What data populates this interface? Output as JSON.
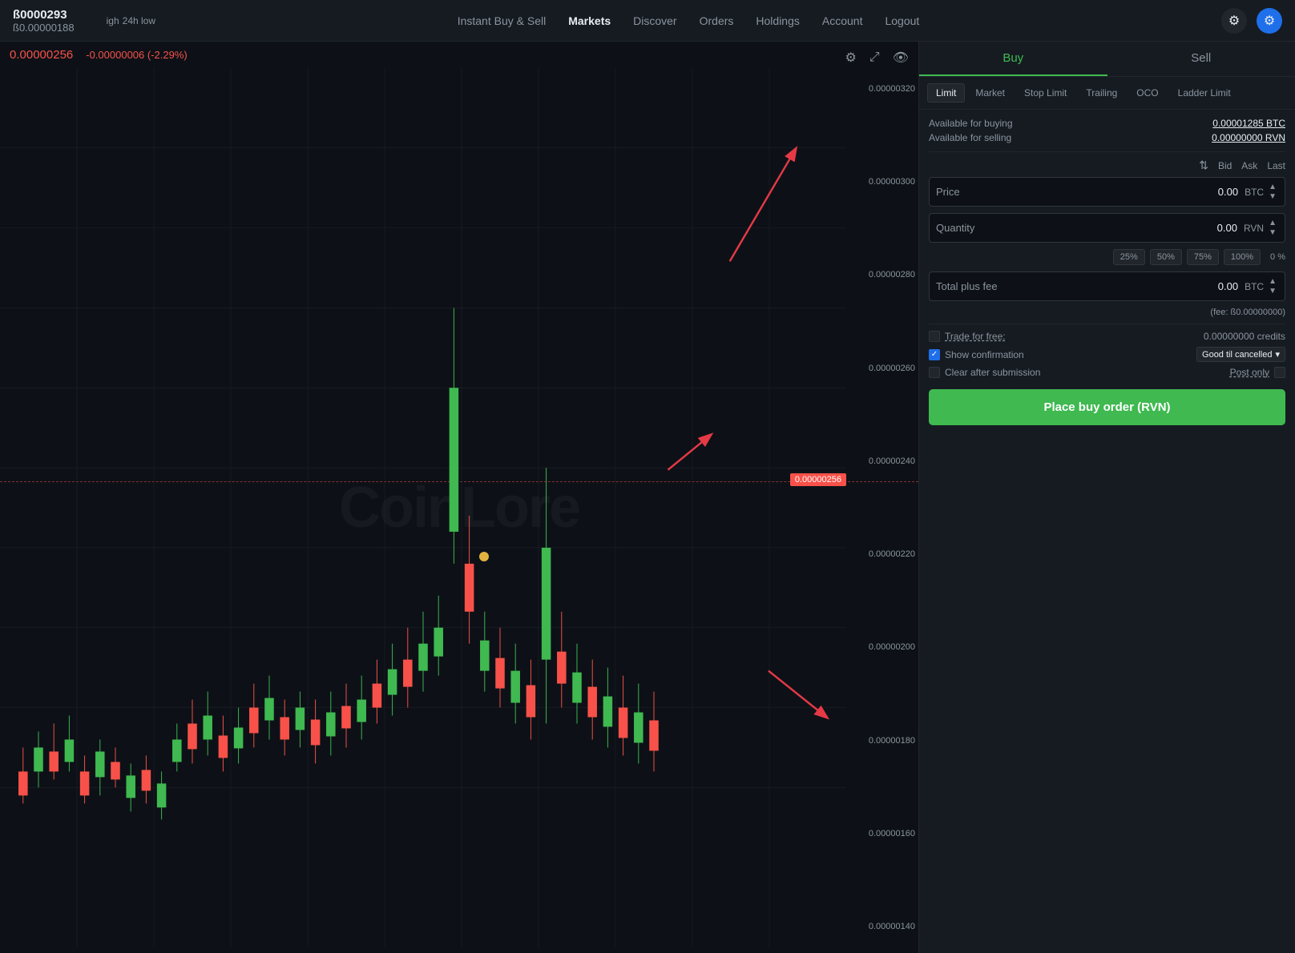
{
  "nav": {
    "ticker": "ß0000293",
    "price_low": "24h low",
    "price_high_label": "igh",
    "price_value": "ß0.00000188",
    "links": [
      {
        "label": "Instant Buy & Sell",
        "active": false
      },
      {
        "label": "Markets",
        "active": true
      },
      {
        "label": "Discover",
        "active": false
      },
      {
        "label": "Orders",
        "active": false
      },
      {
        "label": "Holdings",
        "active": false
      },
      {
        "label": "Account",
        "active": false
      },
      {
        "label": "Logout",
        "active": false
      }
    ]
  },
  "chart": {
    "current_price": "0.00000256",
    "price_change": "-0.00000006 (-2.29%)",
    "watermark": "CoinLore",
    "y_labels": [
      "0.00000320",
      "0.00000300",
      "0.00000280",
      "0.00000260",
      "0.00000240",
      "0.00000220",
      "0.00000200",
      "0.00000180",
      "0.00000160",
      "0.00000140"
    ],
    "price_tag": "0.00000256"
  },
  "order_panel": {
    "buy_label": "Buy",
    "sell_label": "Sell",
    "order_types": [
      "Limit",
      "Market",
      "Stop Limit",
      "Trailing",
      "OCO",
      "Ladder Limit"
    ],
    "available_buying_label": "Available for buying",
    "available_buying_value": "0.00001285 BTC",
    "available_selling_label": "Available for selling",
    "available_selling_value": "0.00000000 RVN",
    "bid_label": "Bid",
    "ask_label": "Ask",
    "last_label": "Last",
    "price_label": "Price",
    "price_value": "0.00",
    "price_currency": "BTC",
    "quantity_label": "Quantity",
    "quantity_value": "0.00",
    "quantity_currency": "RVN",
    "pct_buttons": [
      "25%",
      "50%",
      "75%",
      "100%"
    ],
    "pct_current": "0 %",
    "total_label": "Total plus fee",
    "total_value": "0.00",
    "total_currency": "BTC",
    "fee_label": "(fee: ß0.00000000)",
    "trade_free_label": "Trade for free:",
    "trade_free_value": "0.00000000 credits",
    "show_confirmation_label": "Show confirmation",
    "clear_after_label": "Clear after submission",
    "good_til_label": "Good til cancelled",
    "post_only_label": "Post only",
    "place_order_label": "Place buy order (RVN)"
  }
}
